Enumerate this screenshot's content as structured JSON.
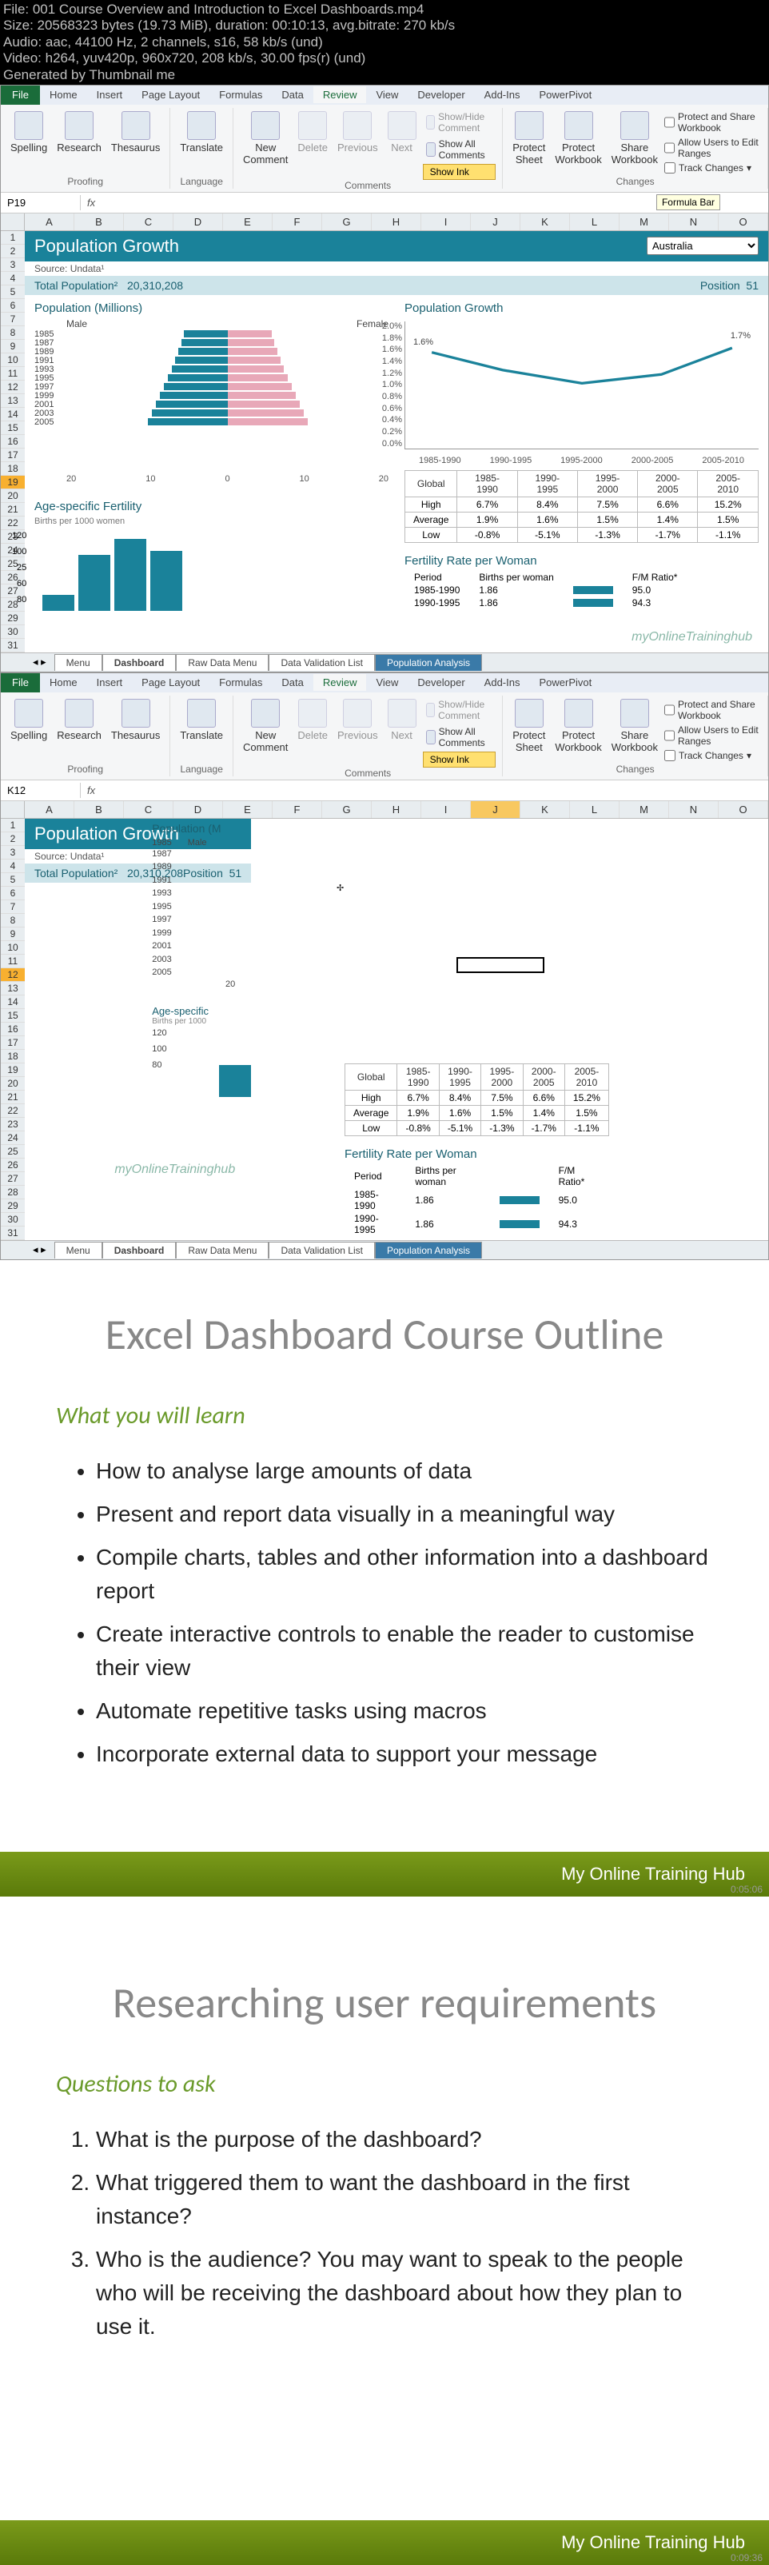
{
  "video_meta": {
    "file": "File: 001 Course Overview and Introduction to Excel Dashboards.mp4",
    "size": "Size: 20568323 bytes (19.73 MiB), duration: 00:10:13, avg.bitrate: 270 kb/s",
    "audio": "Audio: aac, 44100 Hz, 2 channels, s16, 58 kb/s (und)",
    "video": "Video: h264, yuv420p, 960x720, 208 kb/s, 30.00 fps(r) (und)",
    "gen": "Generated by Thumbnail me"
  },
  "ribbon": {
    "file": "File",
    "tabs": [
      "Home",
      "Insert",
      "Page Layout",
      "Formulas",
      "Data",
      "Review",
      "View",
      "Developer",
      "Add-Ins",
      "PowerPivot"
    ],
    "active_tab": "Review",
    "proofing": {
      "spelling": "Spelling",
      "research": "Research",
      "thesaurus": "Thesaurus",
      "label": "Proofing"
    },
    "language": {
      "translate": "Translate",
      "label": "Language"
    },
    "comments": {
      "new": "New\nComment",
      "delete": "Delete",
      "previous": "Previous",
      "next": "Next",
      "showhide": "Show/Hide Comment",
      "showall": "Show All Comments",
      "showink": "Show Ink",
      "label": "Comments"
    },
    "changes": {
      "protect_sheet": "Protect\nSheet",
      "protect_wb": "Protect\nWorkbook",
      "share": "Share\nWorkbook",
      "protect_share": "Protect and Share Workbook",
      "allow_users": "Allow Users to Edit Ranges",
      "track": "Track Changes",
      "label": "Changes"
    }
  },
  "formula_bar1": {
    "name_box": "P19",
    "formula": "",
    "tooltip": "Formula Bar"
  },
  "formula_bar2": {
    "name_box": "K12",
    "formula": ""
  },
  "cols": [
    "A",
    "B",
    "C",
    "D",
    "E",
    "F",
    "G",
    "H",
    "I",
    "J",
    "K",
    "L",
    "M",
    "N",
    "O"
  ],
  "rows1_a": [
    "1",
    "2",
    "3",
    "4",
    "5",
    "6",
    "7",
    "8",
    "9",
    "10",
    "11",
    "12",
    "13",
    "14",
    "15",
    "16",
    "17",
    "18"
  ],
  "rows1_b": [
    "19",
    "20",
    "21",
    "22",
    "23",
    "24",
    "25",
    "26",
    "27",
    "28",
    "29",
    "30",
    "31"
  ],
  "rows2": [
    "1",
    "2",
    "3",
    "4",
    "5",
    "6",
    "7",
    "8",
    "9",
    "10",
    "11",
    "12",
    "13",
    "14",
    "15",
    "16",
    "17",
    "18",
    "19",
    "20",
    "21",
    "22",
    "23",
    "24",
    "25",
    "26",
    "27",
    "28",
    "29",
    "30",
    "31"
  ],
  "dashboard": {
    "title": "Population Growth",
    "country_sel": "Australia",
    "source": "Source: Undata¹",
    "total_pop_label": "Total Population²",
    "total_pop": "20,310,208",
    "position_label": "Position",
    "position": "51",
    "pop_millions": "Population (Millions)",
    "male": "Male",
    "female": "Female",
    "pyramid_years": [
      "1985",
      "1987",
      "1989",
      "1991",
      "1993",
      "1995",
      "1997",
      "1999",
      "2001",
      "2003",
      "2005"
    ],
    "pyramid_axis": [
      "20",
      "10",
      "0",
      "10",
      "20"
    ],
    "growth_title": "Population Growth",
    "growth_y": [
      "2.0%",
      "1.8%",
      "1.6%",
      "1.4%",
      "1.2%",
      "1.0%",
      "0.8%",
      "0.6%",
      "0.4%",
      "0.2%",
      "0.0%"
    ],
    "growth_x": [
      "1985-1990",
      "1990-1995",
      "1995-2000",
      "2000-2005",
      "2005-2010"
    ],
    "growth_labels": {
      "first": "1.6%",
      "last": "1.7%"
    },
    "table_header": [
      "Global",
      "1985-1990",
      "1990-1995",
      "1995-2000",
      "2000-2005",
      "2005-2010"
    ],
    "table_rows": [
      [
        "High",
        "6.7%",
        "8.4%",
        "7.5%",
        "6.6%",
        "15.2%"
      ],
      [
        "Average",
        "1.9%",
        "1.6%",
        "1.5%",
        "1.4%",
        "1.5%"
      ],
      [
        "Low",
        "-0.8%",
        "-5.1%",
        "-1.3%",
        "-1.7%",
        "-1.1%"
      ]
    ],
    "fert_title": "Age-specific Fertility",
    "fert_sub": "Births per 1000 women",
    "fert_y": [
      "120",
      "100",
      "25",
      "60",
      "80"
    ],
    "frw_title": "Fertility Rate per Woman",
    "frw_header": [
      "Period",
      "Births per woman",
      "",
      "F/M Ratio*"
    ],
    "frw_rows": [
      [
        "1985-1990",
        "1.86",
        "",
        "95.0"
      ],
      [
        "1990-1995",
        "1.86",
        "",
        "94.3"
      ]
    ],
    "watermark": "myOnlineTraininghub"
  },
  "sheet_tabs": [
    "Menu",
    "Dashboard",
    "Raw Data Menu",
    "Data Validation List",
    "Population Analysis"
  ],
  "side_panel": {
    "title": "Population (M",
    "male": "Male",
    "years": [
      "1985",
      "1987",
      "1989",
      "1991",
      "1993",
      "1995",
      "1997",
      "1999",
      "2001",
      "2003",
      "2005"
    ],
    "axis": "20",
    "fert_title": "Age-specific",
    "fert_sub": "Births per 1000",
    "fert_y": [
      "120",
      "100",
      "80"
    ]
  },
  "slide1": {
    "title": "Excel Dashboard Course Outline",
    "subtitle": "What you will learn",
    "items": [
      "How to analyse large amounts of data",
      "Present and report data visually in a meaningful way",
      "Compile charts, tables and other information into a dashboard report",
      "Create interactive controls to enable the reader to customise their view",
      "Automate repetitive tasks using macros",
      "Incorporate external data to support your message"
    ],
    "footer": "My Online Training Hub",
    "time": "0:05:06"
  },
  "slide2": {
    "title": "Researching user requirements",
    "subtitle": "Questions to ask",
    "items": [
      "What is the purpose of the dashboard?",
      "What triggered them to want the dashboard in the first instance?",
      "Who is the audience? You may want to speak to the people who will be receiving the dashboard about how they plan to use it."
    ],
    "footer": "My Online Training Hub",
    "time": "0:09:36"
  },
  "chart_data": {
    "population_growth_line": {
      "type": "line",
      "categories": [
        "1985-1990",
        "1990-1995",
        "1995-2000",
        "2000-2005",
        "2005-2010"
      ],
      "values": [
        1.6,
        1.4,
        1.2,
        1.3,
        1.7
      ],
      "ylim": [
        0,
        2.0
      ],
      "ylabel": "%",
      "title": "Population Growth"
    },
    "global_table": {
      "type": "table",
      "columns": [
        "Global",
        "1985-1990",
        "1990-1995",
        "1995-2000",
        "2000-2005",
        "2005-2010"
      ],
      "rows": [
        [
          "High",
          6.7,
          8.4,
          7.5,
          6.6,
          15.2
        ],
        [
          "Average",
          1.9,
          1.6,
          1.5,
          1.4,
          1.5
        ],
        [
          "Low",
          -0.8,
          -5.1,
          -1.3,
          -1.7,
          -1.1
        ]
      ]
    },
    "fertility_rate": {
      "type": "table",
      "columns": [
        "Period",
        "Births per woman",
        "F/M Ratio*"
      ],
      "rows": [
        [
          "1985-1990",
          1.86,
          95.0
        ],
        [
          "1990-1995",
          1.86,
          94.3
        ]
      ]
    }
  }
}
